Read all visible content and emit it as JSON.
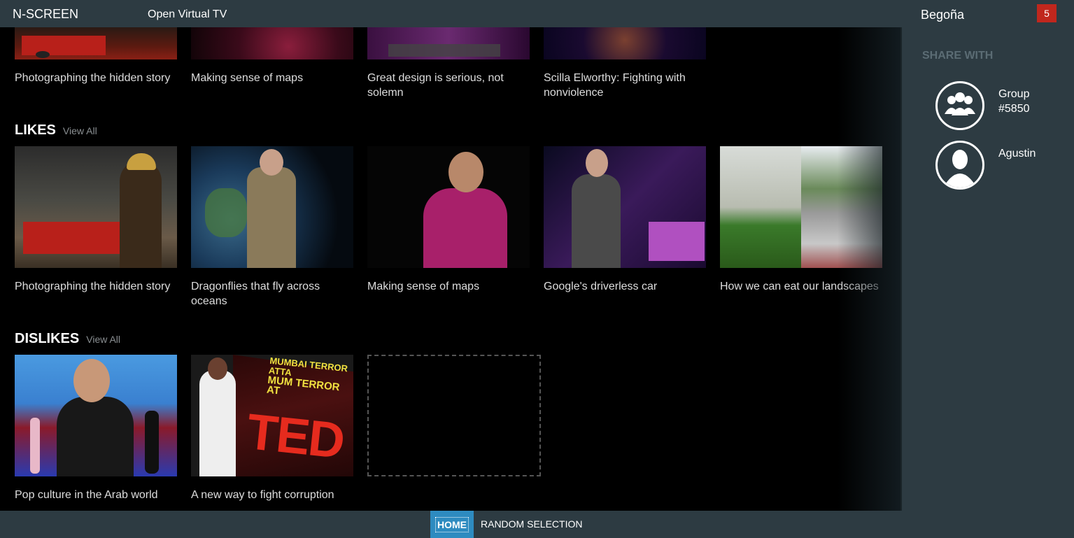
{
  "header": {
    "brand": "N-SCREEN",
    "title": "Open Virtual TV",
    "user": "Begoña",
    "notifications": "5"
  },
  "top_row": [
    {
      "title": "Photographing the hidden story"
    },
    {
      "title": "Making sense of maps"
    },
    {
      "title": "Great design is serious, not solemn"
    },
    {
      "title": "Scilla Elworthy: Fighting with nonviolence"
    }
  ],
  "likes": {
    "heading": "LIKES",
    "view_all": "View All",
    "items": [
      {
        "title": "Photographing the hidden story"
      },
      {
        "title": "Dragonflies that fly across oceans"
      },
      {
        "title": "Making sense of maps"
      },
      {
        "title": "Google's driverless car"
      },
      {
        "title": "How we can eat our landscapes"
      }
    ]
  },
  "dislikes": {
    "heading": "DISLIKES",
    "view_all": "View All",
    "items": [
      {
        "title": "Pop culture in the Arab world"
      },
      {
        "title": "A new way to fight corruption"
      }
    ],
    "ted_text": "TED",
    "banner_line1": "MUMBAI TERROR ATTA",
    "banner_line2": "MUM TERROR AT"
  },
  "share": {
    "heading": "SHARE WITH",
    "contacts": [
      {
        "label": "Group #5850",
        "icon": "group-icon"
      },
      {
        "label": "Agustin",
        "icon": "person-icon"
      }
    ]
  },
  "footer": {
    "home": "HOME",
    "random": "RANDOM SELECTION"
  },
  "colors": {
    "bar": "#2d3b42",
    "accent": "#2e8bc0",
    "badge": "#c0271d"
  }
}
